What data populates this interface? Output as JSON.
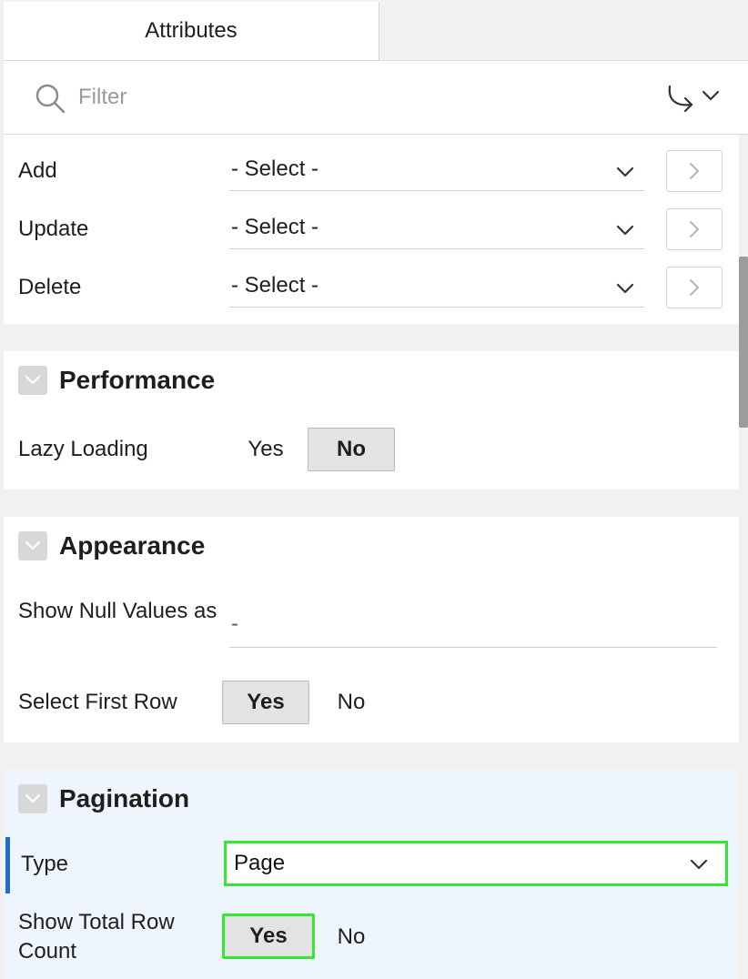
{
  "tabs": {
    "active_label": "Attributes"
  },
  "filter": {
    "placeholder": "Filter"
  },
  "dml": {
    "rows": [
      {
        "label": "Add",
        "value": "- Select -"
      },
      {
        "label": "Update",
        "value": "- Select -"
      },
      {
        "label": "Delete",
        "value": "- Select -"
      }
    ]
  },
  "performance": {
    "title": "Performance",
    "lazy_loading": {
      "label": "Lazy Loading",
      "yes": "Yes",
      "no": "No",
      "selected": "No"
    }
  },
  "appearance": {
    "title": "Appearance",
    "show_null": {
      "label": "Show Null Values as",
      "value": "-"
    },
    "select_first_row": {
      "label": "Select First Row",
      "yes": "Yes",
      "no": "No",
      "selected": "Yes"
    }
  },
  "pagination": {
    "title": "Pagination",
    "type": {
      "label": "Type",
      "value": "Page"
    },
    "show_total": {
      "label": "Show Total Row Count",
      "yes": "Yes",
      "no": "No",
      "selected": "Yes"
    }
  },
  "colors": {
    "highlight": "#35e635",
    "required_marker": "#1f6fc5",
    "pagination_bg": "#eef5fc"
  },
  "icons": [
    "search-icon",
    "go-to-icon",
    "chevron-down-icon",
    "chevron-right-icon",
    "collapse-icon"
  ]
}
